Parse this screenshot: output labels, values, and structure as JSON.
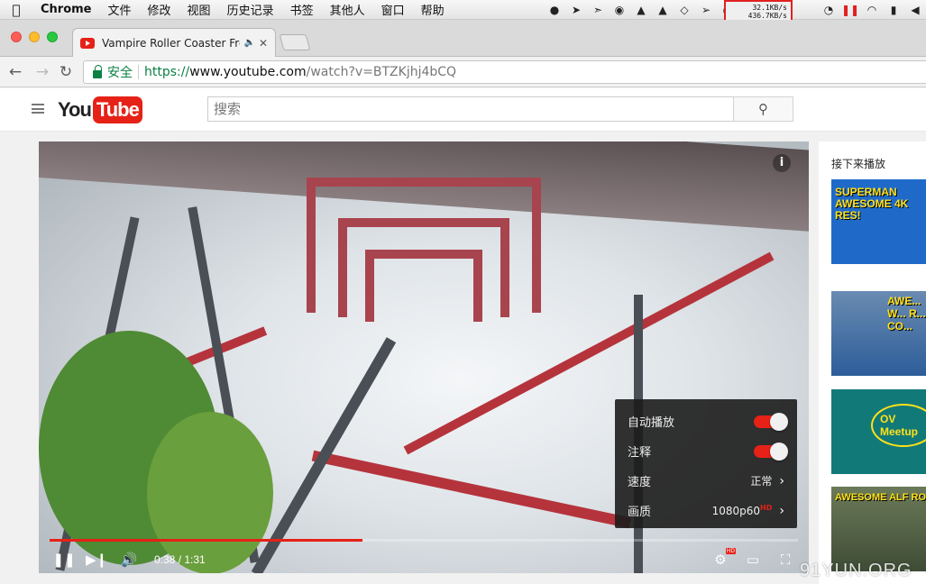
{
  "menubar": {
    "app_name": "Chrome",
    "items": [
      "文件",
      "修改",
      "视图",
      "历史记录",
      "书签",
      "其他人",
      "窗口",
      "帮助"
    ],
    "netspeed_up": "32.1KB/s",
    "netspeed_down": "436.7KB/s"
  },
  "browser": {
    "tab_title": "Vampire Roller Coaster Fro",
    "secure_label": "安全",
    "url_scheme": "https://",
    "url_host": "www.youtube.com",
    "url_path": "/watch?v=BTZKjhj4bCQ"
  },
  "youtube": {
    "logo_you": "You",
    "logo_tube": "Tube",
    "search_placeholder": "搜索"
  },
  "player": {
    "current_time": "0:38",
    "duration": "1:31",
    "time_display": "0:38 / 1:31",
    "progress_fraction": 0.418,
    "settings": {
      "autoplay_label": "自动播放",
      "autoplay_on": true,
      "annotations_label": "注释",
      "annotations_on": true,
      "speed_label": "速度",
      "speed_value": "正常",
      "quality_label": "画质",
      "quality_value": "1080p60",
      "quality_badge": "HD"
    },
    "settings_hd_badge": "HD"
  },
  "sidebar": {
    "up_next_label": "接下来播放",
    "thumb1_text": "SUPERMAN AWESOME 4K RES!",
    "thumb2_text": "AWE... W... R... CO...",
    "thumb3_text": "OV Meetup",
    "thumb4_text": "AWESOME ALF ROLLER COAST"
  },
  "watermark": "91YUN.ORG",
  "colors": {
    "youtube_red": "#e62117",
    "secure_green": "#0b8043",
    "highlight_box": "#e02020"
  }
}
